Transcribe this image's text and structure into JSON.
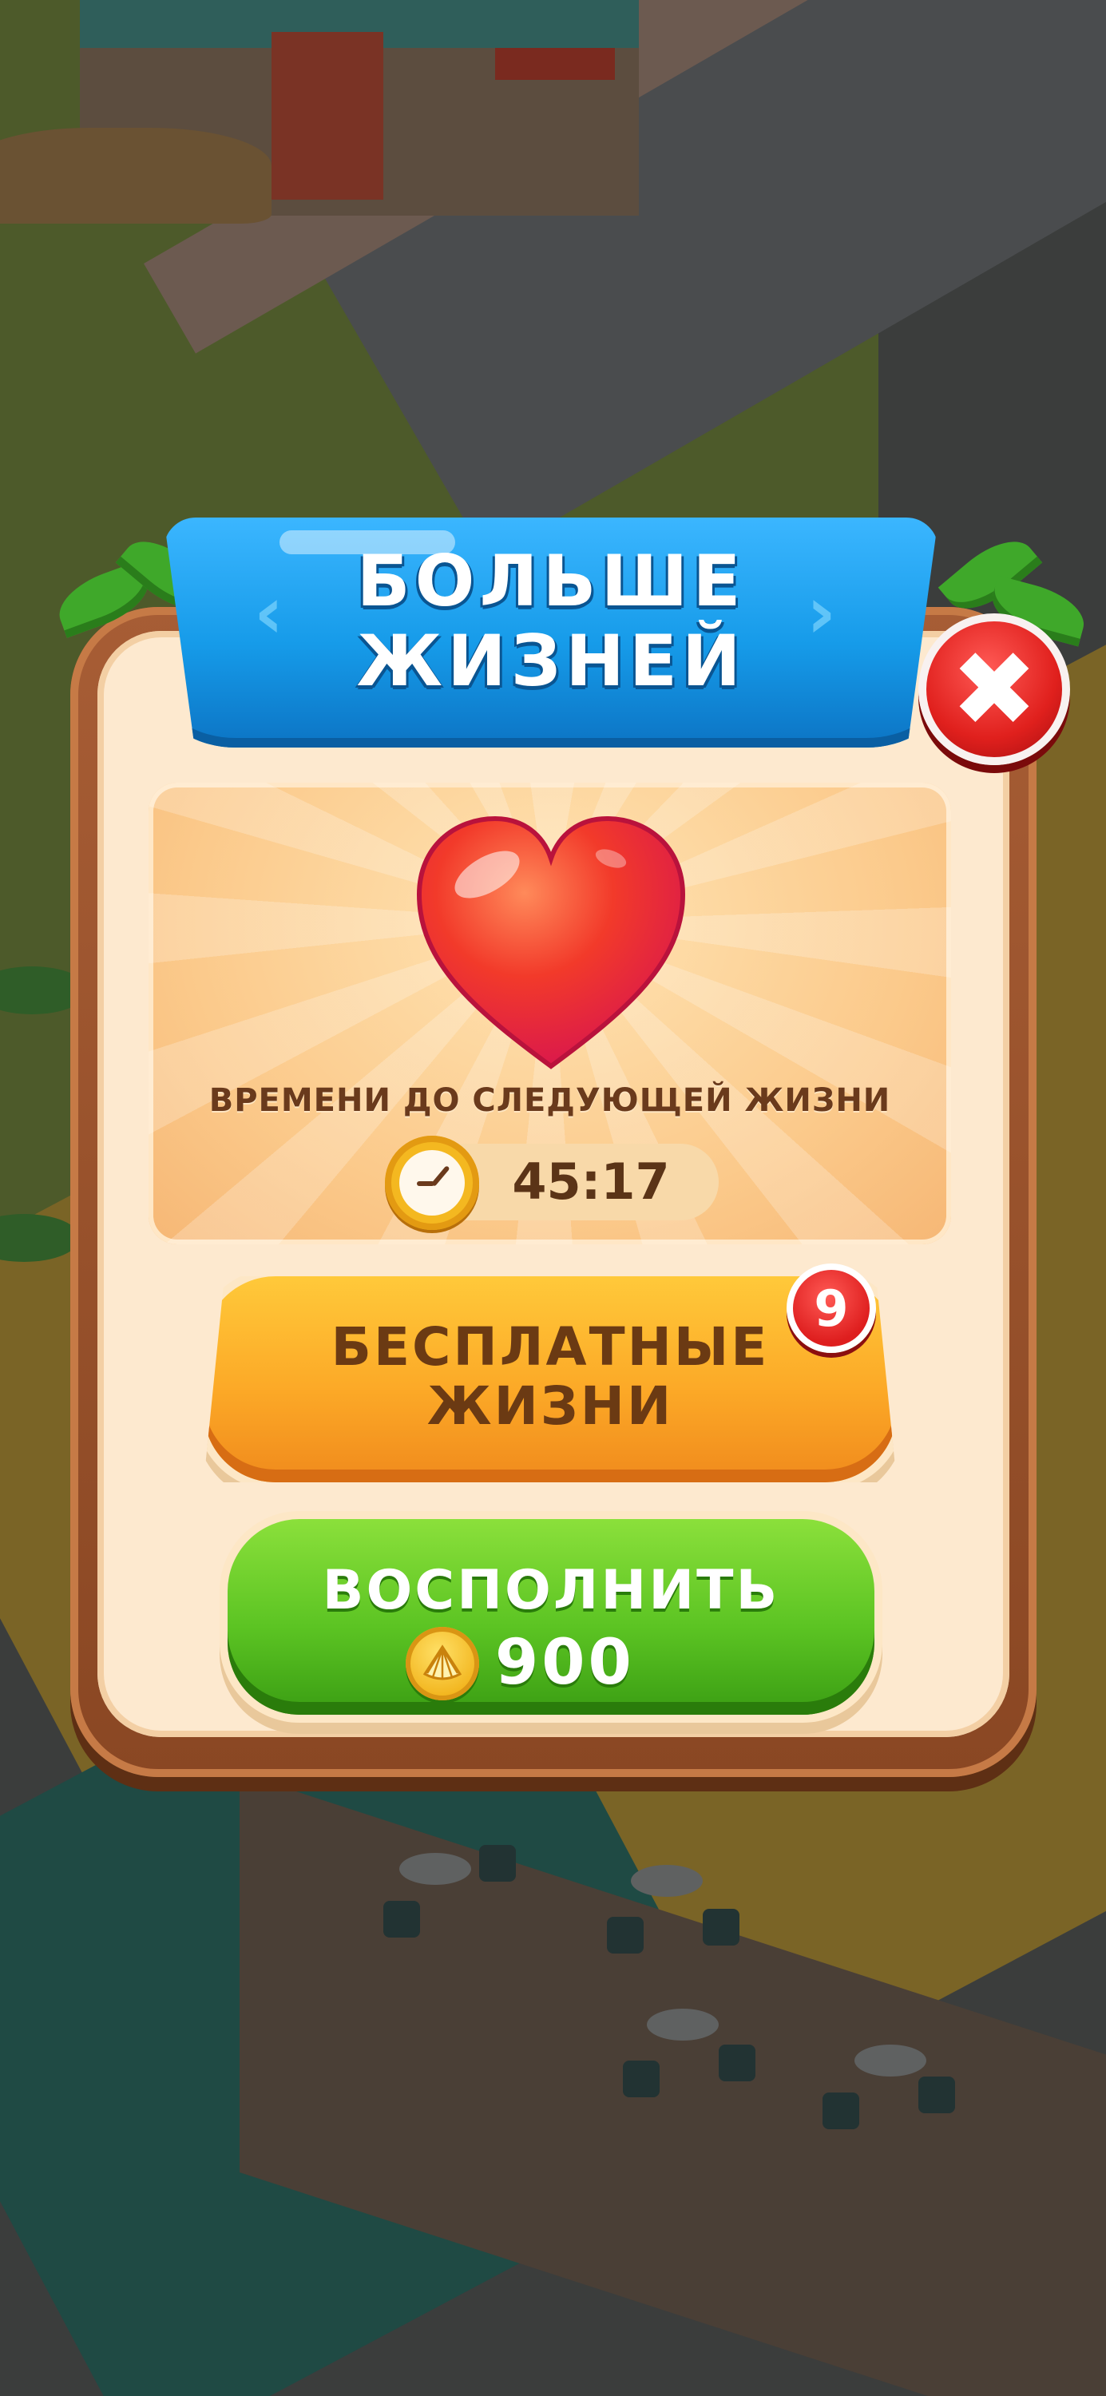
{
  "dialog": {
    "title_line1": "БОЛЬШЕ",
    "title_line2": "ЖИЗНЕЙ",
    "close_symbol": "✖"
  },
  "lives": {
    "next_life_label": "ВРЕМЕНИ ДО СЛЕДУЮЩЕЙ ЖИЗНИ",
    "timer": "45:17"
  },
  "free_lives_button": {
    "line1": "БЕСПЛАТНЫЕ",
    "line2": "ЖИЗНИ",
    "badge_count": "9"
  },
  "refill_button": {
    "label": "ВОСПОЛНИТЬ",
    "price": "900",
    "currency_icon": "shell-coin-icon"
  },
  "colors": {
    "ribbon_blue": "#169be9",
    "panel_cream": "#fde9cf",
    "free_button_orange": "#fca927",
    "refill_button_green": "#5cc423",
    "close_red": "#e0201d",
    "heart_red": "#f23a2a"
  }
}
